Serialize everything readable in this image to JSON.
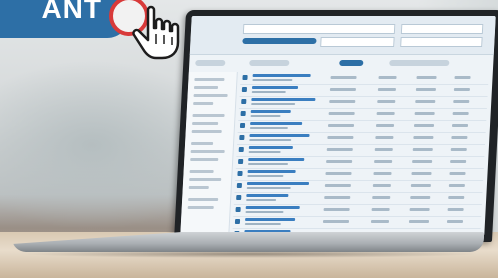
{
  "badge": {
    "text": "ANT",
    "color": "#2d6fa6",
    "ring_color": "#d83a3a"
  },
  "icons": {
    "cursor": "pointer-hand-icon"
  },
  "app_screen": {
    "accent": "#2d6fa6",
    "list_rows": 14,
    "text_readable": false
  }
}
